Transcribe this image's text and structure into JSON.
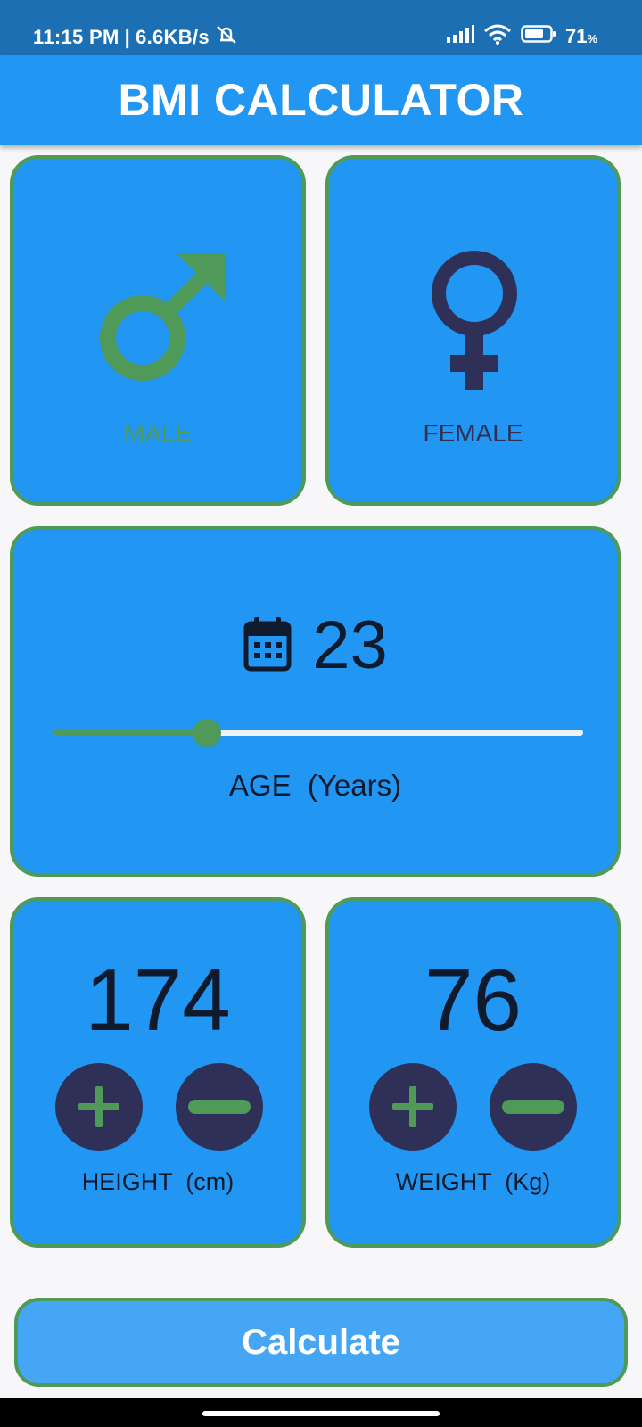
{
  "status_bar": {
    "time": "11:15 PM",
    "speed": "6.6KB/s",
    "battery_percent": "71",
    "battery_unit": "%",
    "icons": [
      "mute-icon",
      "signal-icon",
      "wifi-icon",
      "battery-icon"
    ]
  },
  "app_bar": {
    "title": "BMI CALCULATOR"
  },
  "gender": {
    "male_label": "MALE",
    "female_label": "FEMALE",
    "selected": "male"
  },
  "age": {
    "value": "23",
    "caption": "AGE  (Years)",
    "slider_fraction": 0.29,
    "icon": "calendar-icon"
  },
  "height": {
    "value": "174",
    "caption": "HEIGHT  (cm)"
  },
  "weight": {
    "value": "76",
    "caption": "WEIGHT  (Kg)"
  },
  "calculate_button": {
    "label": "Calculate"
  },
  "colors": {
    "primary": "#2196f3",
    "accent_green": "#4f9a58",
    "dark_navy": "#2f3057",
    "status_bar": "#1d6fb4",
    "button_blue": "#46a6f6"
  }
}
